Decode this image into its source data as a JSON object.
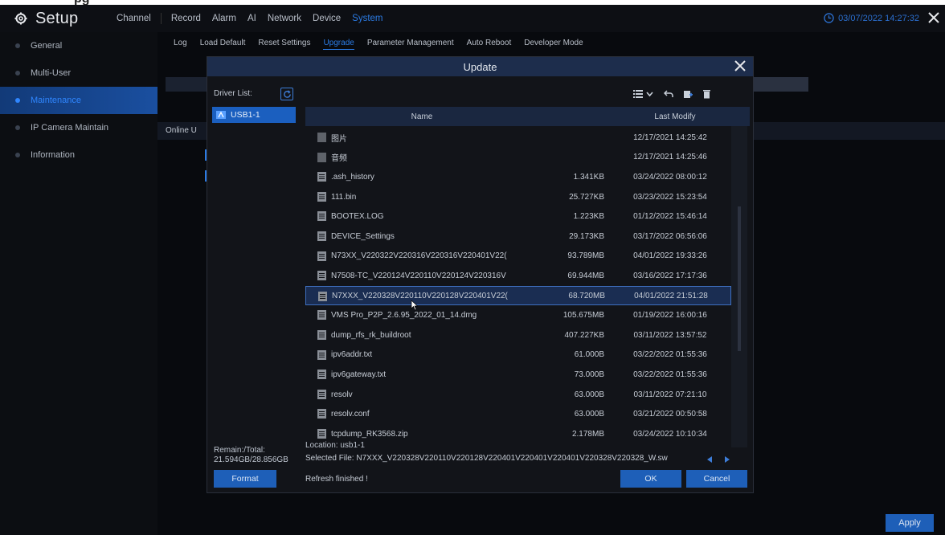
{
  "page_heading_peek": "pg",
  "app": {
    "title": "Setup"
  },
  "main_nav": [
    {
      "label": "Channel",
      "active": false
    },
    {
      "label": "Record",
      "active": false
    },
    {
      "label": "Alarm",
      "active": false
    },
    {
      "label": "AI",
      "active": false
    },
    {
      "label": "Network",
      "active": false
    },
    {
      "label": "Device",
      "active": false
    },
    {
      "label": "System",
      "active": true
    }
  ],
  "clock": "03/07/2022 14:27:32",
  "sidebar": {
    "items": [
      {
        "label": "General",
        "active": false
      },
      {
        "label": "Multi-User",
        "active": false
      },
      {
        "label": "Maintenance",
        "active": true
      },
      {
        "label": "IP Camera Maintain",
        "active": false
      },
      {
        "label": "Information",
        "active": false
      }
    ]
  },
  "sub_nav": [
    {
      "label": "Log",
      "active": false
    },
    {
      "label": "Load Default",
      "active": false
    },
    {
      "label": "Reset Settings",
      "active": false
    },
    {
      "label": "Upgrade",
      "active": true
    },
    {
      "label": "Parameter Management",
      "active": false
    },
    {
      "label": "Auto Reboot",
      "active": false
    },
    {
      "label": "Developer Mode",
      "active": false
    }
  ],
  "background": {
    "online_label": "Online U"
  },
  "apply_label": "Apply",
  "modal": {
    "title": "Update",
    "driver_list_label": "Driver List:",
    "driver": "USB1-1",
    "columns": {
      "name": "Name",
      "size": "",
      "date": "Last Modify"
    },
    "files": [
      {
        "name": "图片",
        "size": "",
        "date": "12/17/2021 14:25:42",
        "type": "folder"
      },
      {
        "name": "音频",
        "size": "",
        "date": "12/17/2021 14:25:46",
        "type": "folder"
      },
      {
        "name": ".ash_history",
        "size": "1.341KB",
        "date": "03/24/2022 08:00:12",
        "type": "file"
      },
      {
        "name": "111.bin",
        "size": "25.727KB",
        "date": "03/23/2022 15:23:54",
        "type": "file"
      },
      {
        "name": "BOOTEX.LOG",
        "size": "1.223KB",
        "date": "01/12/2022 15:46:14",
        "type": "file"
      },
      {
        "name": "DEVICE_Settings",
        "size": "29.173KB",
        "date": "03/17/2022 06:56:06",
        "type": "file"
      },
      {
        "name": "N73XX_V220322V220316V220316V220401V22(",
        "size": "93.789MB",
        "date": "04/01/2022 19:33:26",
        "type": "file"
      },
      {
        "name": "N7508-TC_V220124V220110V220124V220316V",
        "size": "69.944MB",
        "date": "03/16/2022 17:17:36",
        "type": "file"
      },
      {
        "name": "N7XXX_V220328V220110V220128V220401V22(",
        "size": "68.720MB",
        "date": "04/01/2022 21:51:28",
        "type": "file",
        "selected": true
      },
      {
        "name": "VMS Pro_P2P_2.6.95_2022_01_14.dmg",
        "size": "105.675MB",
        "date": "01/19/2022 16:00:16",
        "type": "file"
      },
      {
        "name": "dump_rfs_rk_buildroot",
        "size": "407.227KB",
        "date": "03/11/2022 13:57:52",
        "type": "file"
      },
      {
        "name": "ipv6addr.txt",
        "size": "61.000B",
        "date": "03/22/2022 01:55:36",
        "type": "file"
      },
      {
        "name": "ipv6gateway.txt",
        "size": "73.000B",
        "date": "03/22/2022 01:55:36",
        "type": "file"
      },
      {
        "name": "resolv",
        "size": "63.000B",
        "date": "03/11/2022 07:21:10",
        "type": "file"
      },
      {
        "name": "resolv.conf",
        "size": "63.000B",
        "date": "03/21/2022 00:50:58",
        "type": "file"
      },
      {
        "name": "tcpdump_RK3568.zip",
        "size": "2.178MB",
        "date": "03/24/2022 10:10:34",
        "type": "file"
      }
    ],
    "location": "Location: usb1-1",
    "remain_label": "Remain:/Total:",
    "remain_value": "21.594GB/28.856GB",
    "selected_file": "Selected File:  N7XXX_V220328V220110V220128V220401V220401V220401V220328V220328_W.sw",
    "format_label": "Format",
    "status": "Refresh finished !",
    "ok_label": "OK",
    "cancel_label": "Cancel"
  }
}
